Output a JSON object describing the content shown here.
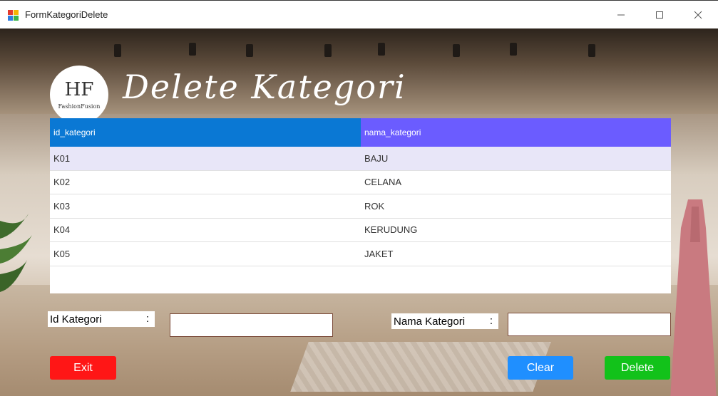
{
  "window": {
    "title": "FormKategoriDelete",
    "icon": "winforms-app-icon",
    "controls": [
      "minimize-icon",
      "maximize-icon",
      "close-icon"
    ]
  },
  "logo": {
    "mark": "HF",
    "text": "FashionFusion"
  },
  "heading": "Delete Kategori",
  "grid": {
    "columns": [
      "id_kategori",
      "nama_kategori"
    ],
    "rows": [
      [
        "K01",
        "BAJU"
      ],
      [
        "K02",
        "CELANA"
      ],
      [
        "K03",
        "ROK"
      ],
      [
        "K04",
        "KERUDUNG"
      ],
      [
        "K05",
        "JAKET"
      ]
    ],
    "selected_row": 0
  },
  "form": {
    "id_label": "Id Kategori",
    "nama_label": "Nama Kategori",
    "colon": ":",
    "id_value": "",
    "nama_value": ""
  },
  "buttons": {
    "exit": "Exit",
    "clear": "Clear",
    "delete": "Delete"
  },
  "colors": {
    "header_id": "#0a78d4",
    "header_nama": "#6b5cff",
    "exit": "#ff1616",
    "clear": "#1f8fff",
    "delete": "#12c21a"
  }
}
